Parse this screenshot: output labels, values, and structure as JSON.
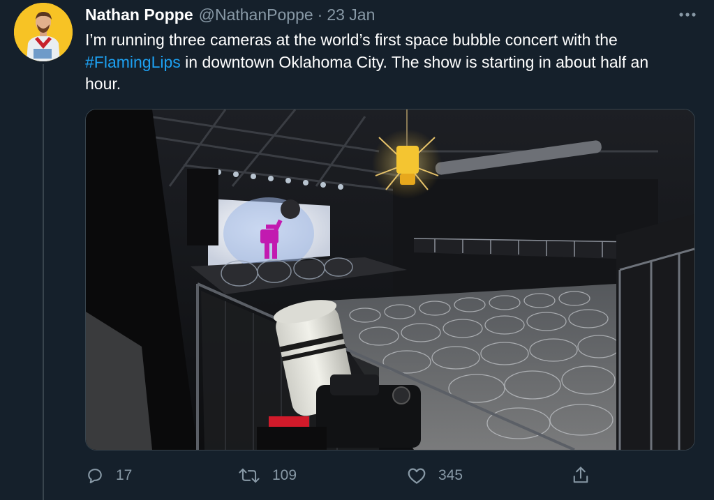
{
  "tweet": {
    "author": {
      "display_name": "Nathan Poppe",
      "handle": "@NathanPoppe",
      "separator": "·",
      "date": "23 Jan"
    },
    "text": {
      "part1": "I’m running three cameras at the world’s first space bubble concert with the ",
      "hashtag": "#FlamingLips",
      "part2": " in downtown Oklahoma City. The show is starting in about half an hour."
    },
    "media": {
      "icon": "concert-venue-photo"
    },
    "actions": {
      "reply_count": "17",
      "retweet_count": "109",
      "like_count": "345"
    }
  },
  "colors": {
    "background": "#15202b",
    "text": "#ffffff",
    "secondary": "#8899a6",
    "link": "#1da1f2",
    "border": "#38444d",
    "avatar_bg": "#f7c325"
  }
}
